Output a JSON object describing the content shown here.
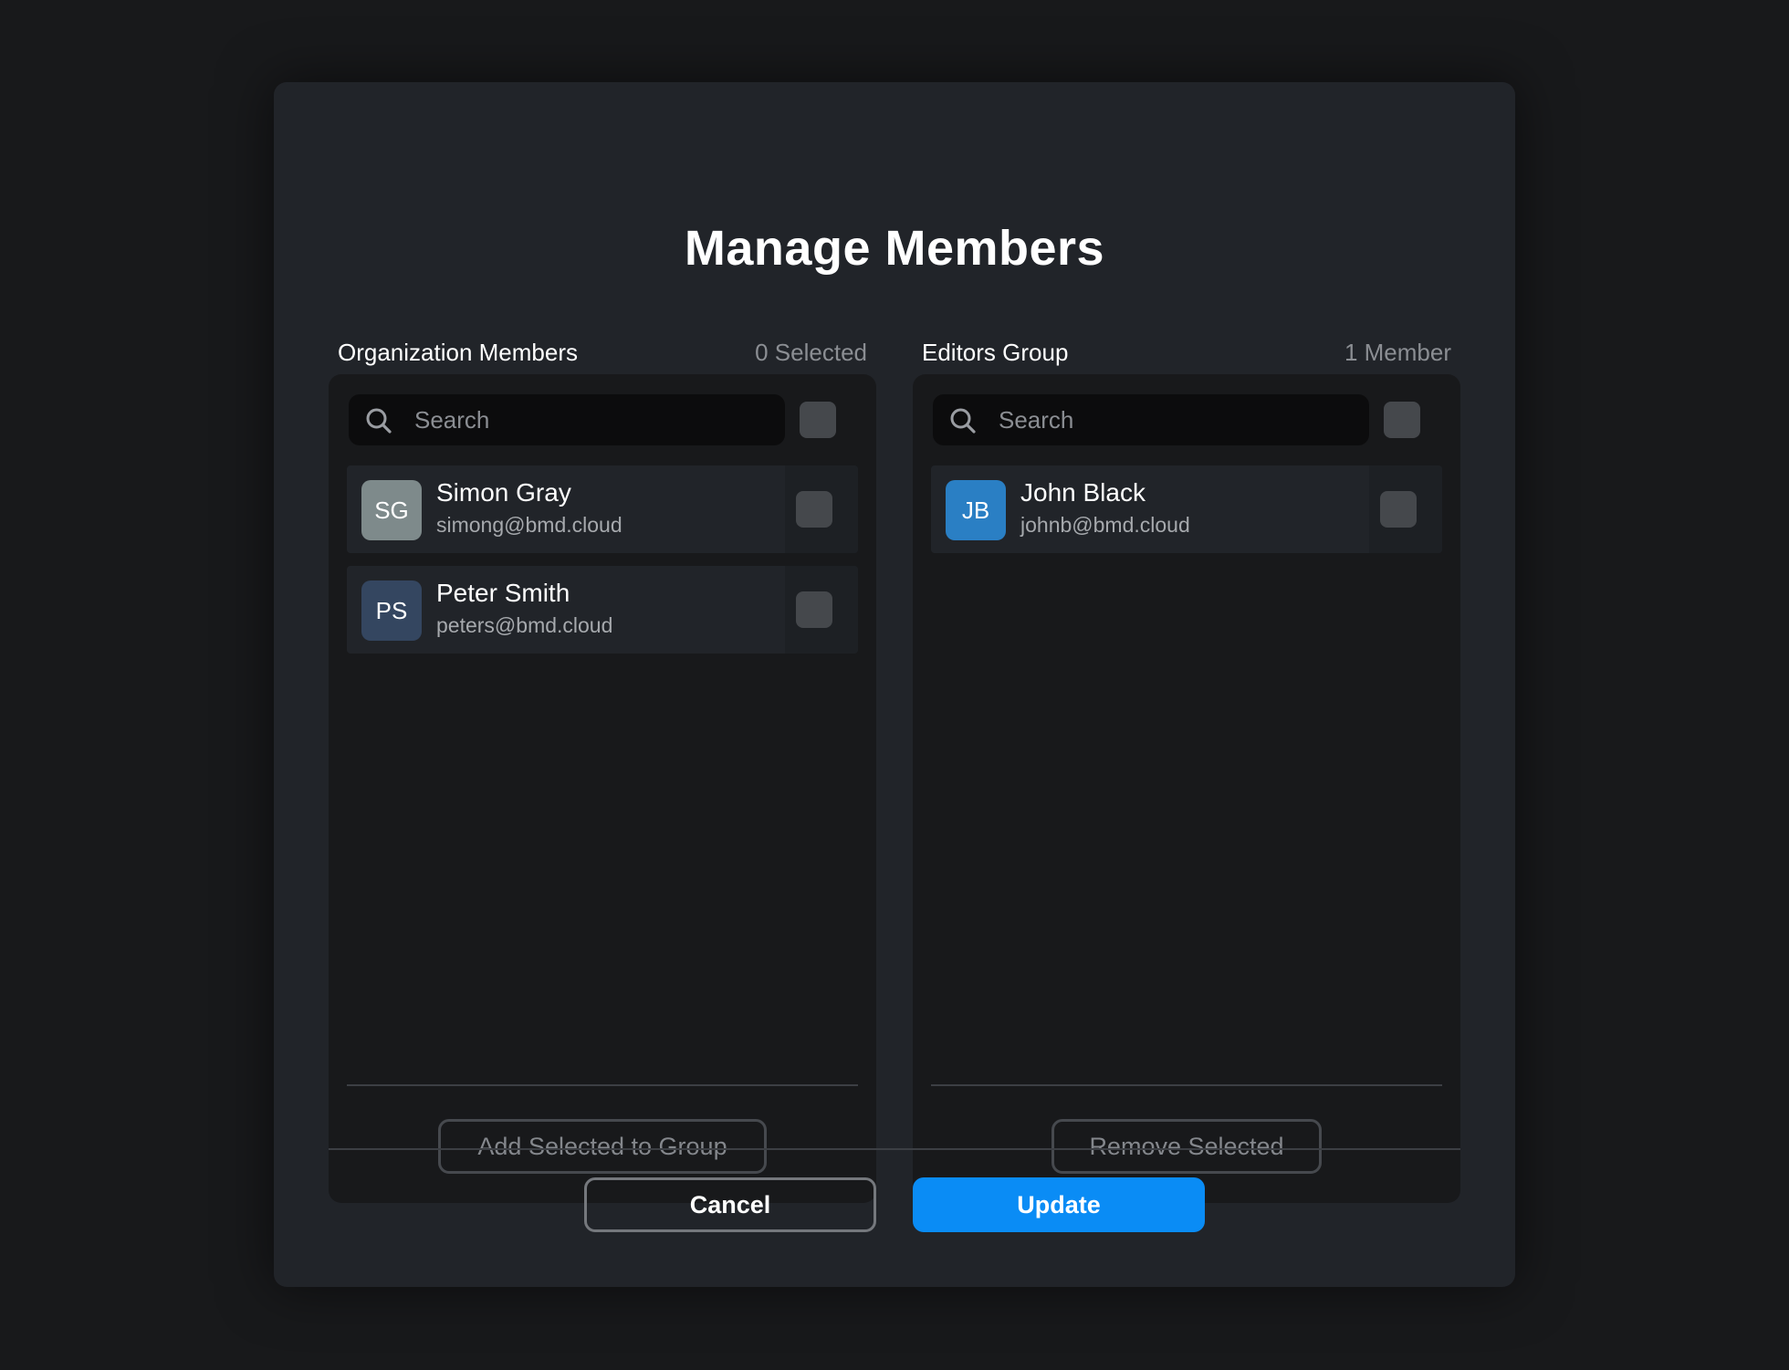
{
  "dialog": {
    "title": "Manage Members"
  },
  "org_panel": {
    "title": "Organization Members",
    "count_label": "0 Selected",
    "search_placeholder": "Search",
    "members": [
      {
        "initials": "SG",
        "name": "Simon Gray",
        "email": "simong@bmd.cloud",
        "avatar_color": "#7e8a8b"
      },
      {
        "initials": "PS",
        "name": "Peter Smith",
        "email": "peters@bmd.cloud",
        "avatar_color": "#344660"
      }
    ],
    "action_label": "Add Selected to Group"
  },
  "group_panel": {
    "title": "Editors Group",
    "count_label": "1 Member",
    "search_placeholder": "Search",
    "members": [
      {
        "initials": "JB",
        "name": "John Black",
        "email": "johnb@bmd.cloud",
        "avatar_color": "#2a7fc4"
      }
    ],
    "action_label": "Remove Selected"
  },
  "footer": {
    "cancel_label": "Cancel",
    "update_label": "Update"
  },
  "colors": {
    "accent": "#0a8cf5",
    "background": "#18191b",
    "dialog": "#212429"
  },
  "icons": {
    "search": "search-icon"
  }
}
